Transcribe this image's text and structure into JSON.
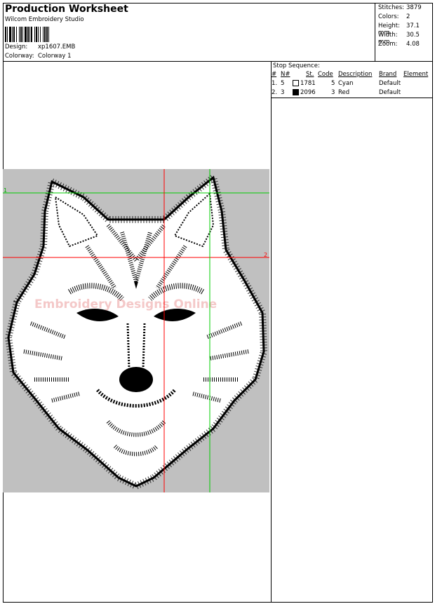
{
  "header": {
    "title": "Production Worksheet",
    "vendor": "Wilcom  Embroidery Studio",
    "design_label": "Design:",
    "design_value": "xp1607.EMB",
    "colorway_label": "Colorway:",
    "colorway_value": "Colorway  1"
  },
  "stats": [
    {
      "label": "Stitches:",
      "value": "3879"
    },
    {
      "label": "Colors:",
      "value": "2"
    },
    {
      "label": "Height:",
      "value": "37.1 mm"
    },
    {
      "label": "Width:",
      "value": "30.5 mm"
    },
    {
      "label": "Zoom:",
      "value": "4.08"
    }
  ],
  "stop_sequence": {
    "label": "Stop Sequence:",
    "headers": {
      "num": "#",
      "n": "N#",
      "st": "St.",
      "code": "Code",
      "desc": "Description",
      "brand": "Brand",
      "element": "Element"
    },
    "rows": [
      {
        "num": "1.",
        "n": "5",
        "st": "1781",
        "code": "5",
        "desc": "Cyan",
        "brand": "Default",
        "swatch_color": "#ffffff"
      },
      {
        "num": "2.",
        "n": "3",
        "st": "2096",
        "code": "3",
        "desc": "Red",
        "brand": "Default",
        "swatch_color": "#000000"
      }
    ]
  },
  "design_canvas": {
    "background": "#c0c0c0",
    "guide_h1_label": "1",
    "guide_h2_label": "2",
    "guide_colors": {
      "green": "#00cc00",
      "red": "#ff0000"
    },
    "watermark": "Embroidery Designs Online"
  }
}
